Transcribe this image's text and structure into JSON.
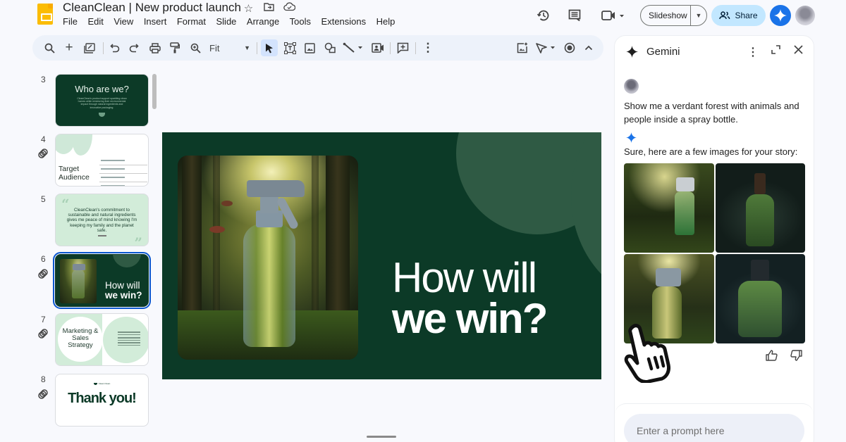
{
  "app": {
    "doc_title": "CleanClean | New product launch",
    "title_icons": [
      "star-icon",
      "move-to-folder-icon",
      "cloud-saved-icon"
    ],
    "menu": [
      "File",
      "Edit",
      "View",
      "Insert",
      "Format",
      "Slide",
      "Arrange",
      "Tools",
      "Extensions",
      "Help"
    ]
  },
  "top_right": {
    "slideshow_label": "Slideshow",
    "share_label": "Share",
    "icons": [
      "version-history-icon",
      "comments-icon",
      "meet-icon",
      "gemini-icon",
      "account-avatar"
    ]
  },
  "toolbar": {
    "zoom_value": "Fit",
    "tools": [
      "search-menus",
      "new-slide",
      "edit-slide-layout",
      "undo",
      "redo",
      "print",
      "paint-format",
      "zoom",
      "select",
      "text-box",
      "image",
      "shape",
      "line",
      "video",
      "comment",
      "more",
      "insert-image-generate",
      "select-cursor",
      "record",
      "collapse"
    ]
  },
  "filmstrip": {
    "slides": [
      {
        "num": "3",
        "title": "Who are we?",
        "body": "CleanClean's product support sparkling clean homes while minimizing their environmental impact through natural ingredients and innovative packaging.",
        "linked": false,
        "selected": false
      },
      {
        "num": "4",
        "title_l1": "Target",
        "title_l2": "Audience",
        "linked": true,
        "selected": false
      },
      {
        "num": "5",
        "quote": "CleanClean's commitment to sustainable and natural ingredients gives me peace of mind knowing I'm keeping my family and the planet safe.",
        "linked": false,
        "selected": false
      },
      {
        "num": "6",
        "title_l1": "How will",
        "title_l2": "we win?",
        "linked": true,
        "selected": true
      },
      {
        "num": "7",
        "title": "Marketing & Sales Strategy",
        "linked": true,
        "selected": false
      },
      {
        "num": "8",
        "brand": "Clean Clean",
        "title": "Thank you!",
        "linked": true,
        "selected": false
      }
    ]
  },
  "main_slide": {
    "title_l1": "How will",
    "title_l2": "we win?",
    "image_alt": "Spray bottle containing a verdant forest with animals and people"
  },
  "gemini": {
    "title": "Gemini",
    "user_prompt": "Show me a verdant forest with animals and people inside a spray bottle.",
    "response": "Sure, here are a few images for your story:",
    "images": [
      "Forest path with spray bottle of green liquid",
      "Pump bottle with forest and giraffe inside",
      "Trigger spray bottle with forest and elephant inside",
      "Mist spray bottle with forest and person inside"
    ],
    "input_placeholder": "Enter a prompt here"
  },
  "colors": {
    "slide_green": "#0c3a27",
    "accent_green": "#2f5a44",
    "share_bg": "#c2e7ff",
    "gemini_blue": "#1a73e8",
    "slides_yellow": "#fbbc04"
  }
}
